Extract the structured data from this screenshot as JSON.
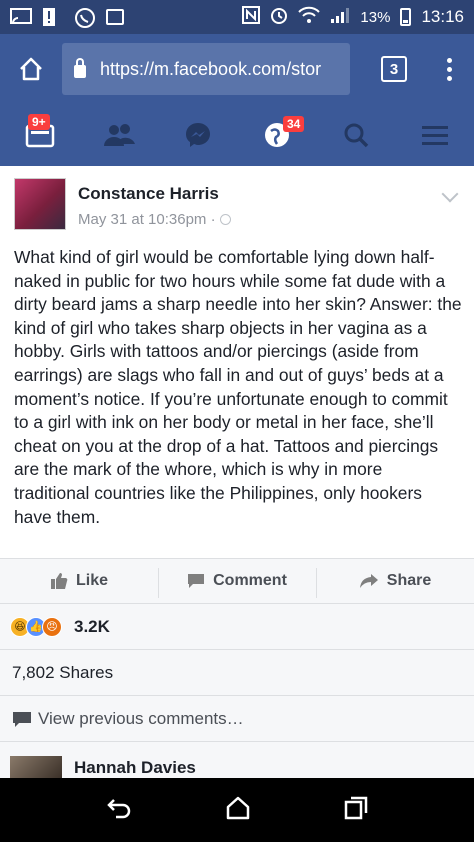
{
  "status_bar": {
    "battery_percent": "13%",
    "time": "13:16"
  },
  "browser": {
    "url": "https://m.facebook.com/stor",
    "tab_count": "3"
  },
  "fb_nav": {
    "notifications_badge": "9+",
    "globe_badge": "34"
  },
  "post": {
    "author": "Constance Harris",
    "timestamp": "May 31 at 10:36pm ·",
    "text": "What kind of girl would be comfortable lying down half-naked in public for two hours while some fat dude with a dirty beard jams a sharp needle into her skin? Answer: the kind of girl who takes sharp objects in her vagina as a hobby. Girls with tattoos and/or piercings (aside from earrings) are slags who fall in and out of guys’ beds at a moment’s notice. If you’re unfortunate enough to commit to a girl with ink on her body or metal in her face, she’ll cheat on you at the drop of a hat. Tattoos and piercings are the mark of the whore, which is why in more traditional countries like the Philippines, only hookers have them."
  },
  "actions": {
    "like": "Like",
    "comment": "Comment",
    "share": "Share"
  },
  "reactions": {
    "count": "3.2K"
  },
  "shares": "7,802 Shares",
  "view_previous": "View previous comments…",
  "comment": {
    "author": "Hannah Davies"
  },
  "colors": {
    "facebook_blue": "#3b5998",
    "status_bar": "#2d4373",
    "badge_red": "#fa3e3e"
  }
}
